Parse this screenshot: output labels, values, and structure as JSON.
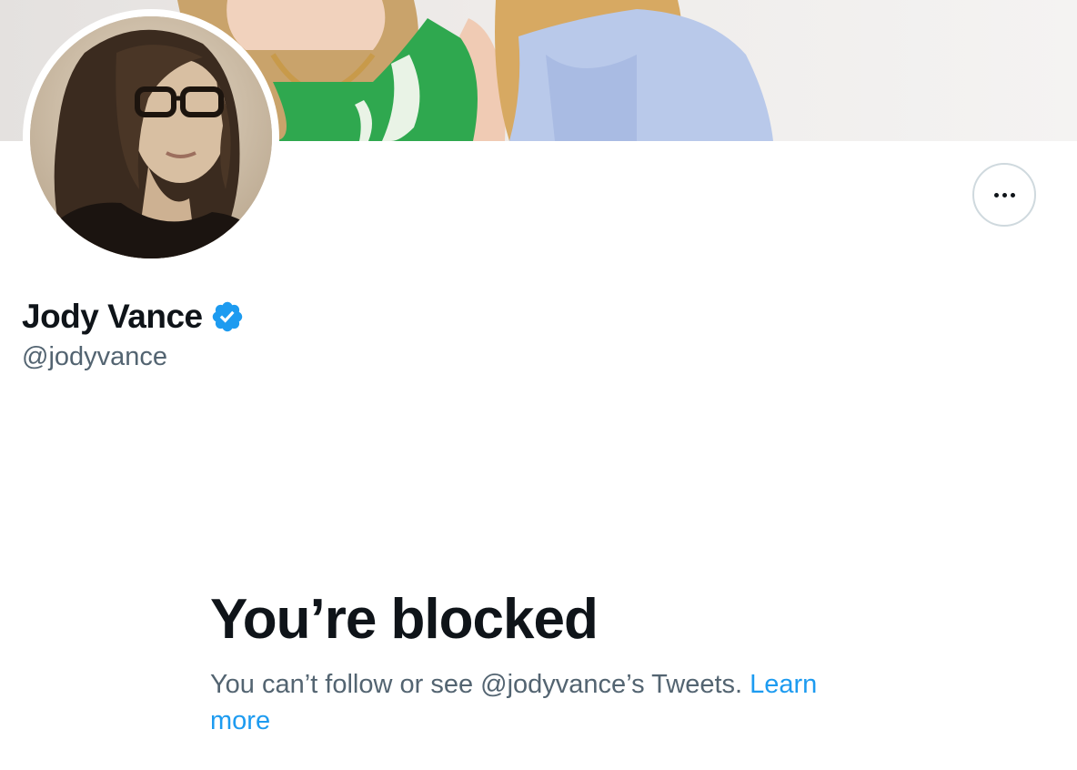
{
  "profile": {
    "display_name": "Jody Vance",
    "handle": "@jodyvance",
    "verified": true,
    "verified_icon": "verified-badge-icon",
    "more_icon": "more-horizontal-icon"
  },
  "blocked": {
    "title": "You’re blocked",
    "message": "You can’t follow or see @jodyvance’s Tweets.",
    "link_label": "Learn more"
  },
  "colors": {
    "text_primary": "#0f1419",
    "text_secondary": "#536471",
    "accent": "#1d9bf0",
    "border": "#cfd9de"
  }
}
